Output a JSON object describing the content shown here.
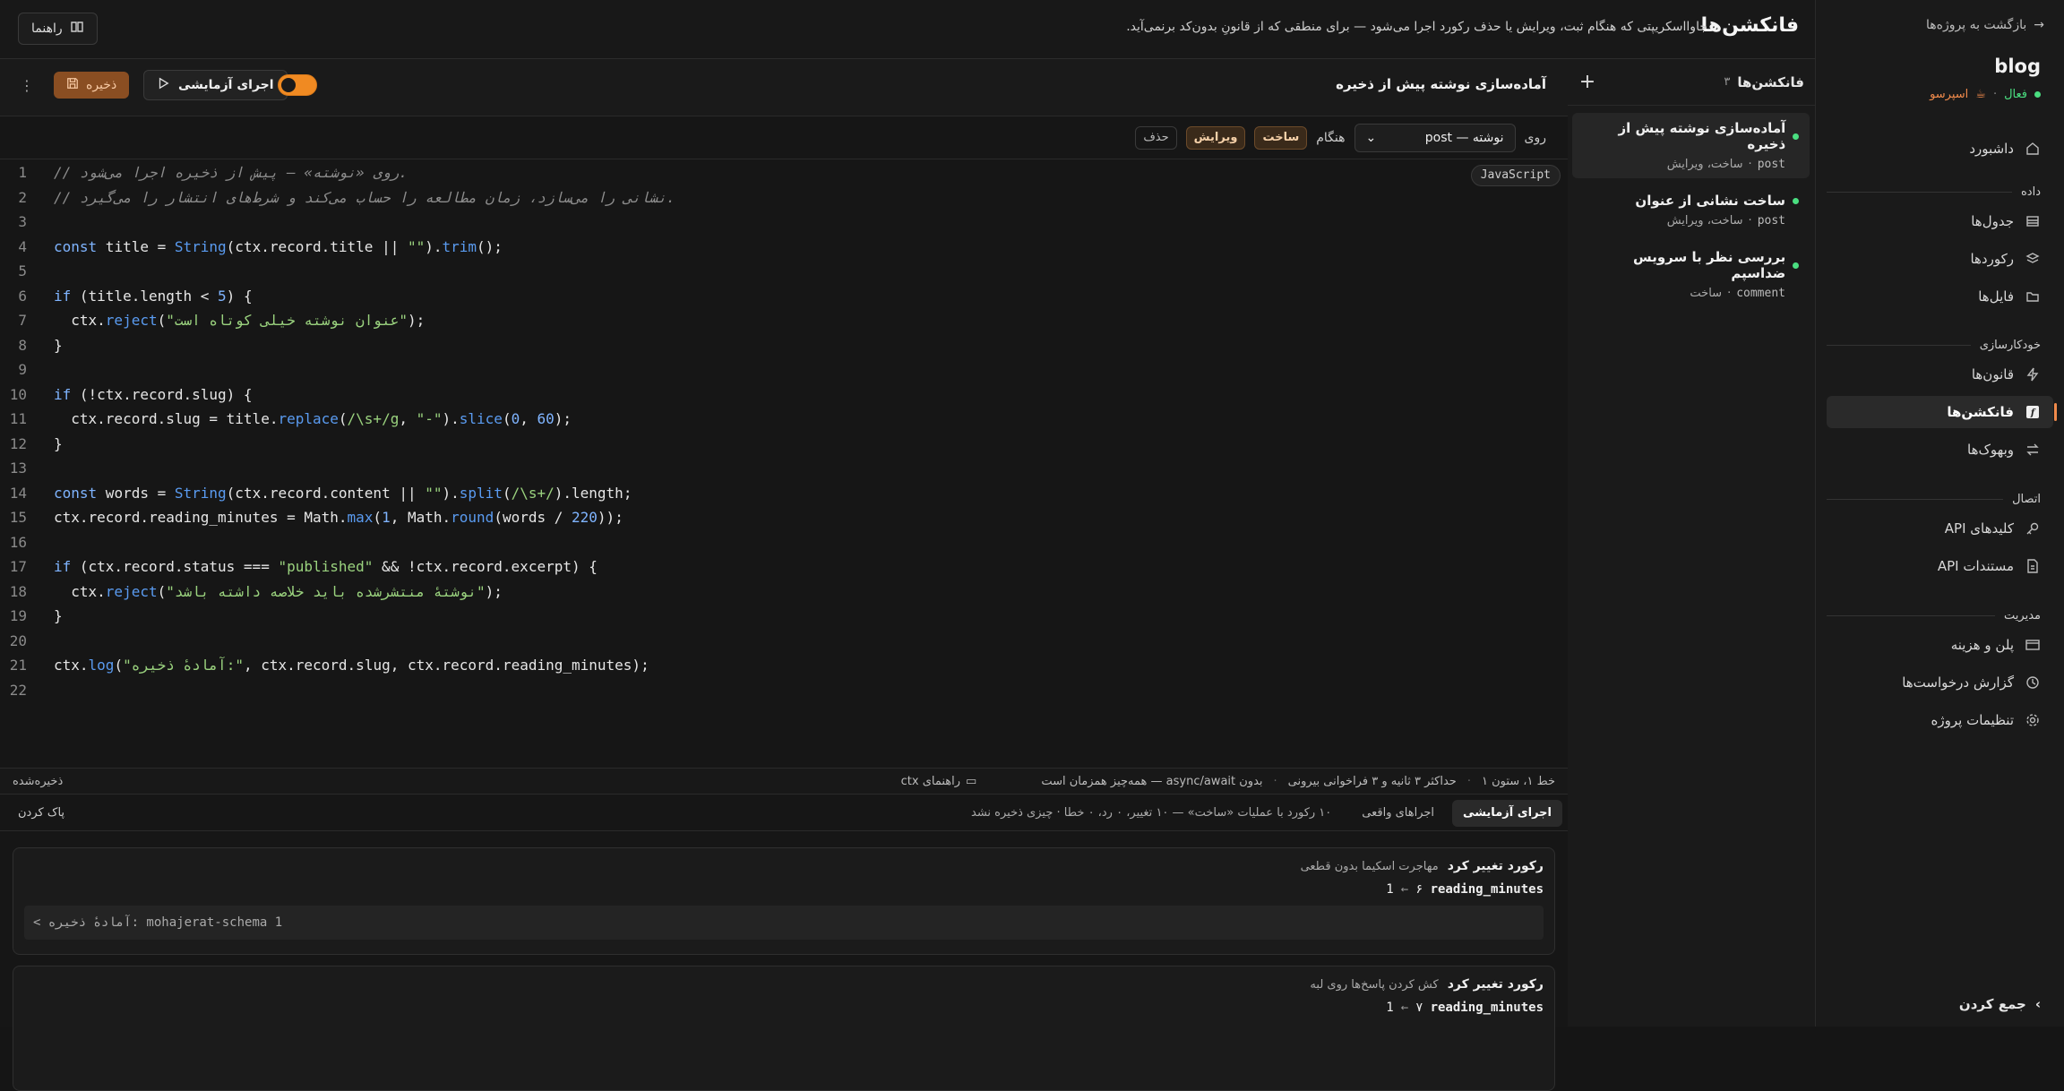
{
  "sidebar": {
    "back": "بازگشت به پروژه‌ها",
    "project": "blog",
    "status": "فعال",
    "plan": "اسپرسو",
    "sections": [
      {
        "items": [
          {
            "label": "داشبورد",
            "icon": "home-icon"
          }
        ]
      },
      {
        "title": "داده",
        "items": [
          {
            "label": "جدول‌ها",
            "icon": "table-icon"
          },
          {
            "label": "رکوردها",
            "icon": "layers-icon"
          },
          {
            "label": "فایل‌ها",
            "icon": "folder-icon"
          }
        ]
      },
      {
        "title": "خودکارسازی",
        "items": [
          {
            "label": "قانون‌ها",
            "icon": "bolt-icon"
          },
          {
            "label": "فانکشن‌ها",
            "icon": "function-icon",
            "active": true
          },
          {
            "label": "وبهوک‌ها",
            "icon": "arrows-icon"
          }
        ]
      },
      {
        "title": "اتصال",
        "items": [
          {
            "label": "کلیدهای API",
            "icon": "key-icon"
          },
          {
            "label": "مستندات API",
            "icon": "doc-icon"
          }
        ]
      },
      {
        "title": "مدیریت",
        "items": [
          {
            "label": "پلن و هزینه",
            "icon": "card-icon"
          },
          {
            "label": "گزارش درخواست‌ها",
            "icon": "history-icon"
          },
          {
            "label": "تنظیمات پروژه",
            "icon": "gear-icon"
          }
        ]
      }
    ],
    "collapse": "جمع کردن"
  },
  "header": {
    "title": "فانکشن‌ها",
    "desc": "جاوااسکریپتی که هنگام ثبت، ویرایش یا حذف رکورد اجرا می‌شود — برای منطقی که از قانونِ بدون‌کد برنمی‌آید.",
    "guide": "راهنما"
  },
  "fnlist": {
    "title": "فانکشن‌ها",
    "count": "۳",
    "items": [
      {
        "name": "آماده‌سازی نوشته پیش از ذخیره",
        "table": "post",
        "events": "ساخت، ویرایش",
        "selected": true
      },
      {
        "name": "ساخت نشانی از عنوان",
        "table": "post",
        "events": "ساخت، ویرایش"
      },
      {
        "name": "بررسی نظر با سرویس ضداسپم",
        "table": "comment",
        "events": "ساخت"
      }
    ]
  },
  "editor": {
    "name": "آماده‌سازی نوشته پیش از ذخیره",
    "save": "ذخیره",
    "run": "اجرای آزمایشی",
    "on_label": "روی",
    "table_select": "نوشته — post",
    "when_label": "هنگام",
    "ev_create": "ساخت",
    "ev_edit": "ویرایش",
    "ev_delete": "حذف",
    "lang": "JavaScript",
    "status_pos": "خط ۱، ستون ۱",
    "status_limit": "حداکثر ۳ ثانیه و ۳ فراخوانی بیرونی",
    "status_async": "بدون async/await — همه‌چیز همزمان است",
    "status_ctx": "راهنمای ctx",
    "status_saved": "ذخیره‌شده"
  },
  "results": {
    "tab_test": "اجرای آزمایشی",
    "tab_real": "اجراهای واقعی",
    "info": "۱۰ رکورد با عملیات «ساخت» — ۱۰ تغییر، ۰ رد، ۰ خطا · چیزی ذخیره نشد",
    "clear": "پاک کردن",
    "cards": [
      {
        "title": "رکورد تغییر کرد",
        "record": "مهاجرت اسکیما بدون قطعی",
        "field": "reading_minutes",
        "from": "۶",
        "to": "1",
        "log": "< آمادهٔ ذخیره: mohajerat-schema 1"
      },
      {
        "title": "رکورد تغییر کرد",
        "record": "کش کردن پاسخ‌ها روی لبه",
        "field": "reading_minutes",
        "from": "۷",
        "to": "1"
      }
    ]
  }
}
